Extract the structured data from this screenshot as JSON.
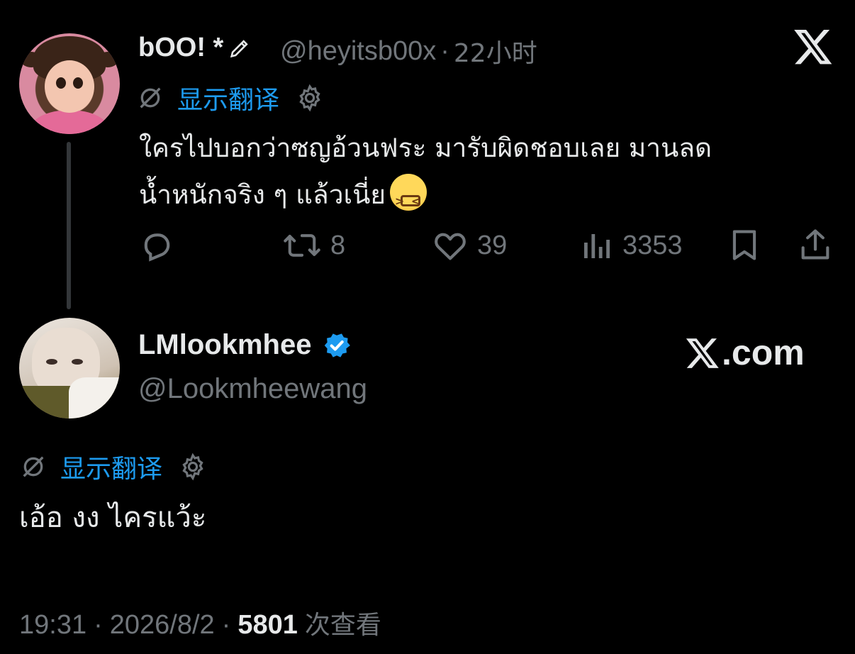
{
  "parent_tweet": {
    "author_name": "bOO! *",
    "author_handle": "@heyitsb00x",
    "separator": "·",
    "time": "22小时",
    "translate_label": "显示翻译",
    "text_line1": "ใครไปบอกว่าซญอ้วนฟระ มารับผิดชอบเลย มานลด",
    "text_line2": "น้ำหนักจริง ๆ แล้วเนี่ย",
    "emoji": "tired-face-emoji",
    "counts": {
      "retweets": "8",
      "likes": "39",
      "views": "3353"
    }
  },
  "main_tweet": {
    "author_name": "LMlookmhee",
    "author_handle": "@Lookmheewang",
    "translate_label": "显示翻译",
    "text": "เอ้อ งง ไครแว้ะ",
    "timestamp_time": "19:31",
    "timestamp_date": "2026/8/2",
    "separator": "·",
    "views_count": "5801",
    "views_label": "次查看"
  },
  "branding": {
    "x_logo_text": ".com"
  },
  "icons": {
    "close": "x-logo-icon",
    "translate": "no-translate-icon",
    "settings": "gear-icon",
    "reply": "reply-icon",
    "retweet": "retweet-icon",
    "like": "heart-icon",
    "views": "views-bar-chart-icon",
    "bookmark": "bookmark-icon",
    "share": "share-icon",
    "verified": "verified-badge-icon",
    "pencil": "pencil-icon"
  },
  "colors": {
    "background": "#000000",
    "text": "#e7e9ea",
    "muted": "#71767b",
    "accent": "#1d9bf0",
    "thread_line": "#333639"
  }
}
